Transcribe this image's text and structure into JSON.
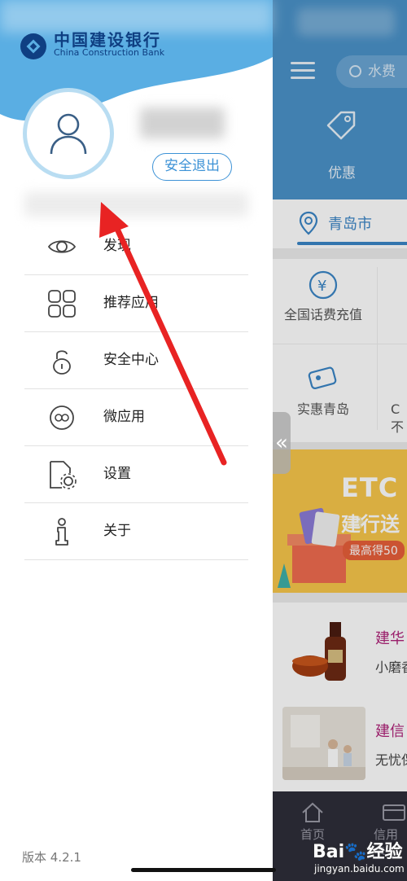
{
  "drawer": {
    "bank_name_cn": "中国建设银行",
    "bank_name_en": "China Construction Bank",
    "logout_label": "安全退出",
    "menu": [
      {
        "label": "发现",
        "icon": "eye-icon"
      },
      {
        "label": "推荐应用",
        "icon": "app-grid-icon"
      },
      {
        "label": "安全中心",
        "icon": "lock-icon"
      },
      {
        "label": "微应用",
        "icon": "mini-app-icon"
      },
      {
        "label": "设置",
        "icon": "settings-icon"
      },
      {
        "label": "关于",
        "icon": "info-icon"
      }
    ],
    "version": "版本 4.2.1"
  },
  "background_app": {
    "search_placeholder": "水费",
    "discount_label": "优惠",
    "city": "青岛市",
    "grid": [
      {
        "label": "全国话费充值"
      },
      {
        "label": "实惠青岛"
      }
    ],
    "grid_partial": [
      "C",
      "不"
    ],
    "banner": {
      "title": "ETC",
      "subtitle": "建行送",
      "pill": "最高得50"
    },
    "products": [
      {
        "title": "建华",
        "subtitle": "小磨香"
      },
      {
        "title": "建信",
        "subtitle": "无忧保"
      }
    ],
    "tabs": [
      {
        "label": "首页"
      },
      {
        "label": "信用卡"
      }
    ]
  },
  "overlay": {
    "collapse_glyph": "«",
    "watermark_logo": "Bai🐾经验",
    "watermark_url": "jingyan.baidu.com"
  },
  "colors": {
    "brand_blue": "#3c92d6",
    "header_blue": "#4a92c9",
    "arrow_red": "#e82323"
  }
}
